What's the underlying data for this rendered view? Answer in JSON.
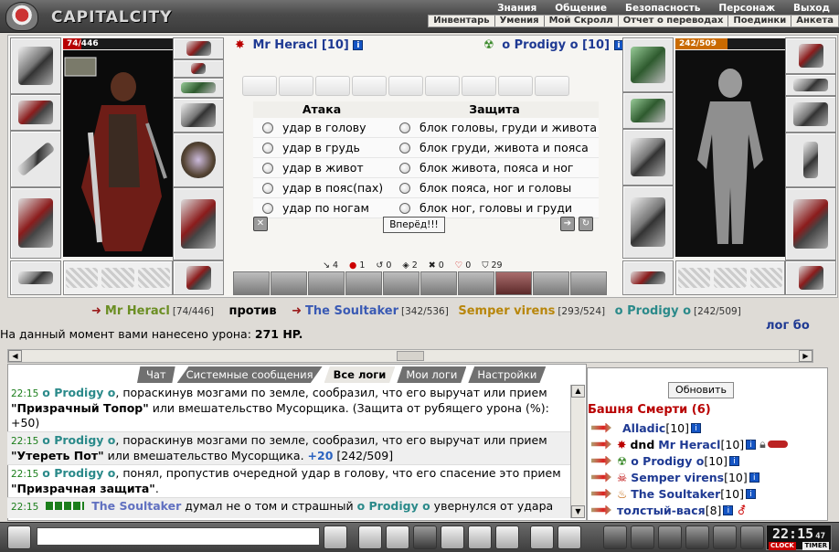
{
  "header": {
    "logo": "CAPITALCITY",
    "menu_top": [
      "Знания",
      "Общение",
      "Безопасность",
      "Персонаж",
      "Выход"
    ],
    "menu_sub": [
      "Инвентарь",
      "Умения",
      "Мой Скролл",
      "Отчет о переводах",
      "Поединки",
      "Анкета"
    ]
  },
  "fighter_left": {
    "name": "Mr Heracl",
    "level": "[10]",
    "hp": "74/446",
    "hp_fraction": 0.166
  },
  "fighter_right": {
    "name": "o Prodigy o",
    "level": "[10]",
    "hp": "242/509",
    "hp_fraction": 0.475
  },
  "attack": {
    "title": "Атака",
    "options": [
      "удар в голову",
      "удар в грудь",
      "удар в живот",
      "удар в пояс(пах)",
      "удар по ногам"
    ]
  },
  "defense": {
    "title": "Защита",
    "options": [
      "блок головы, груди и живота",
      "блок груди, живота и пояса",
      "блок живота, пояса и ног",
      "блок пояса, ног и головы",
      "блок ног, головы и груди"
    ]
  },
  "go_button": "Вперёд!!!",
  "stats": [
    "4",
    "1",
    "0",
    "2",
    "0",
    "0",
    "29"
  ],
  "versus": {
    "left_name": "Mr Heracl",
    "left_hp": "[74/446]",
    "against": "против",
    "r1_name": "The Soultaker",
    "r1_hp": "[342/536]",
    "r2_name": "Semper virens",
    "r2_hp": "[293/524]",
    "r3_name": "o Prodigy o",
    "r3_hp": "[242/509]"
  },
  "damage": {
    "text": "На данный момент вами нанесено урона:",
    "value": "271 HP."
  },
  "log_side": "лог бо",
  "tabs": [
    "Чат",
    "Системные сообщения",
    "Все логи",
    "Мои логи",
    "Настройки"
  ],
  "log": [
    {
      "time": "22:15",
      "name": "o Prodigy o",
      "pre": ", пораскинув мозгами по земле, сообразил, что его выручат или прием ",
      "bold": "\"Призрачный Топор\"",
      "post": " или вмешательство Мусорщика. (Защита от рубящего урона (%): +50)"
    },
    {
      "time": "22:15",
      "name": "o Prodigy o",
      "pre": ", пораскинув мозгами по земле, сообразил, что его выручат или прием ",
      "bold": "\"Утереть Пот\"",
      "post": " или вмешательство Мусорщика. ",
      "num": "+20",
      "tail": " [242/509]"
    },
    {
      "time": "22:15",
      "name": "o Prodigy o",
      "pre": ", понял, пропустив очередной удар в голову, что его спасение это прием ",
      "bold": "\"Призрачная защита\"",
      "post": "."
    },
    {
      "time": "22:15",
      "name": "The Soultaker",
      "pre": " думал не о том и страшный ",
      "name_b": "o Prodigy o",
      "post": " увернулся от удара мечом в колено."
    }
  ],
  "players": {
    "refresh": "Обновить",
    "location": "Башня Смерти (6)",
    "list": [
      {
        "name": "Alladic",
        "level": "[10]"
      },
      {
        "name": "Mr Heracl",
        "level": "[10]",
        "prefix": "dnd"
      },
      {
        "name": "o Prodigy o",
        "level": "[10]"
      },
      {
        "name": "Semper virens",
        "level": "[10]"
      },
      {
        "name": "The Soultaker",
        "level": "[10]"
      },
      {
        "name": "толстый-вася",
        "level": "[8]"
      }
    ]
  },
  "clock": {
    "time": "22:15",
    "seconds": "47",
    "clock_label": "CLOCK",
    "timer_label": "TIMER"
  }
}
